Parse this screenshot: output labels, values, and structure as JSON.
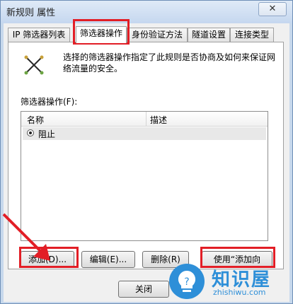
{
  "window": {
    "title": "新规则 属性",
    "close_glyph": "✕"
  },
  "tabs": [
    {
      "label": "IP 筛选器列表",
      "active": false
    },
    {
      "label": "筛选器操作",
      "active": true
    },
    {
      "label": "身份验证方法",
      "active": false
    },
    {
      "label": "隧道设置",
      "active": false
    },
    {
      "label": "连接类型",
      "active": false
    }
  ],
  "description": {
    "icon": "filter-action-icon",
    "text": "选择的筛选器操作指定了此规则是否协商及如何来保证网络流量的安全。"
  },
  "filter_actions": {
    "label": "筛选器操作(F):",
    "columns": {
      "name": "名称",
      "description": "描述"
    },
    "rows": [
      {
        "name": "阻止",
        "description": ""
      }
    ]
  },
  "buttons": {
    "add": "添加(D)...",
    "edit": "编辑(E)...",
    "delete": "删除(R)",
    "use_wizard": "使用“添加向",
    "close": "关闭"
  },
  "watermark": {
    "title": "知识屋",
    "url": "zhishiwu.com"
  },
  "colors": {
    "highlight": "#e21e26",
    "watermark": "#2e8fd8"
  }
}
